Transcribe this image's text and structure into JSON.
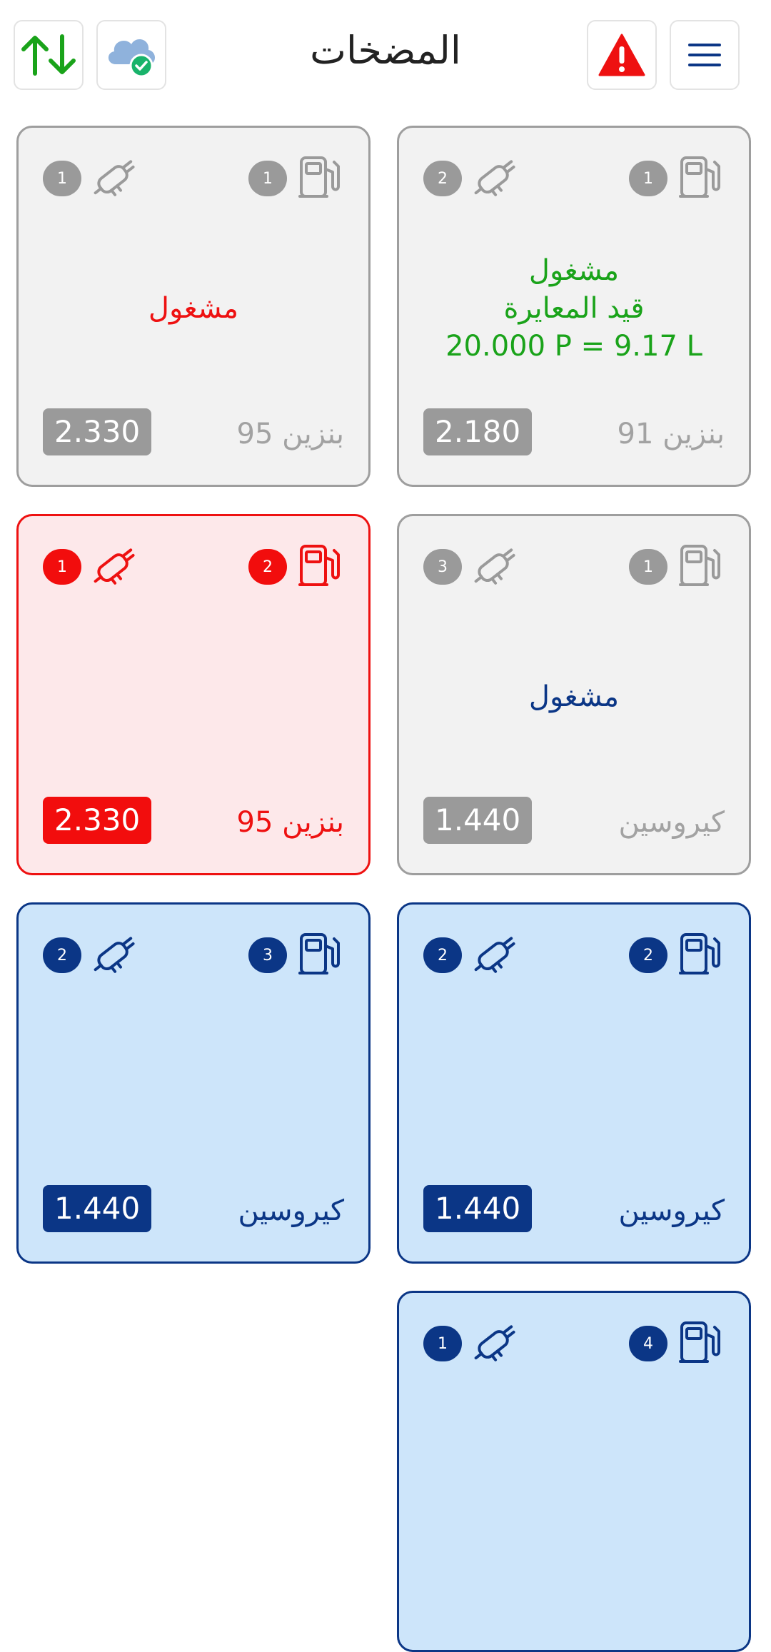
{
  "header": {
    "title": "المضخات",
    "menu_icon": "hamburger-menu-icon",
    "alert_icon": "warning-triangle-icon",
    "cloud_icon": "cloud-sync-check-icon",
    "transfer_icon": "up-down-arrows-icon"
  },
  "colors": {
    "grey": "#9a9a9a",
    "red": "#ee1111",
    "blue": "#0b3686",
    "green": "#1aa31a",
    "card_grey_bg": "#f2f2f2",
    "card_red_bg": "#fde8ea",
    "card_blue_bg": "#cde5fa"
  },
  "pumps": [
    {
      "pump_number": "1",
      "nozzle_number": "2",
      "status_lines": [
        "مشغول",
        "قيد المعايرة",
        "20.000 P = 9.17 L"
      ],
      "fuel": "بنزين 91",
      "price": "2.180",
      "theme": "grey"
    },
    {
      "pump_number": "1",
      "nozzle_number": "1",
      "status_lines": [
        "مشغول"
      ],
      "fuel": "بنزين 95",
      "price": "2.330",
      "theme": "grey"
    },
    {
      "pump_number": "1",
      "nozzle_number": "3",
      "status_lines": [
        "مشغول"
      ],
      "fuel": "كيروسين",
      "price": "1.440",
      "theme": "grey"
    },
    {
      "pump_number": "2",
      "nozzle_number": "1",
      "status_lines": [],
      "fuel": "بنزين 95",
      "price": "2.330",
      "theme": "red"
    },
    {
      "pump_number": "2",
      "nozzle_number": "2",
      "status_lines": [],
      "fuel": "كيروسين",
      "price": "1.440",
      "theme": "blue"
    },
    {
      "pump_number": "3",
      "nozzle_number": "2",
      "status_lines": [],
      "fuel": "كيروسين",
      "price": "1.440",
      "theme": "blue"
    },
    {
      "pump_number": "4",
      "nozzle_number": "1",
      "status_lines": [],
      "fuel": "",
      "price": "",
      "theme": "blue"
    }
  ]
}
